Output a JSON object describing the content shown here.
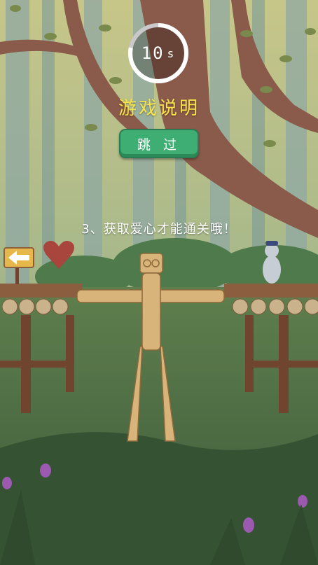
{
  "timer": {
    "value": "10",
    "unit": "s",
    "remaining_fraction": 0.78
  },
  "title": "游戏说明",
  "skip_button": {
    "label": "跳 过"
  },
  "instruction": "3、获取爱心才能通关哦！",
  "colors": {
    "title": "#f6e34a",
    "button": "#3fae73",
    "heart": "#a8453d"
  },
  "icons": [
    "arrow-sign-icon",
    "heart-icon",
    "bear-icon"
  ]
}
